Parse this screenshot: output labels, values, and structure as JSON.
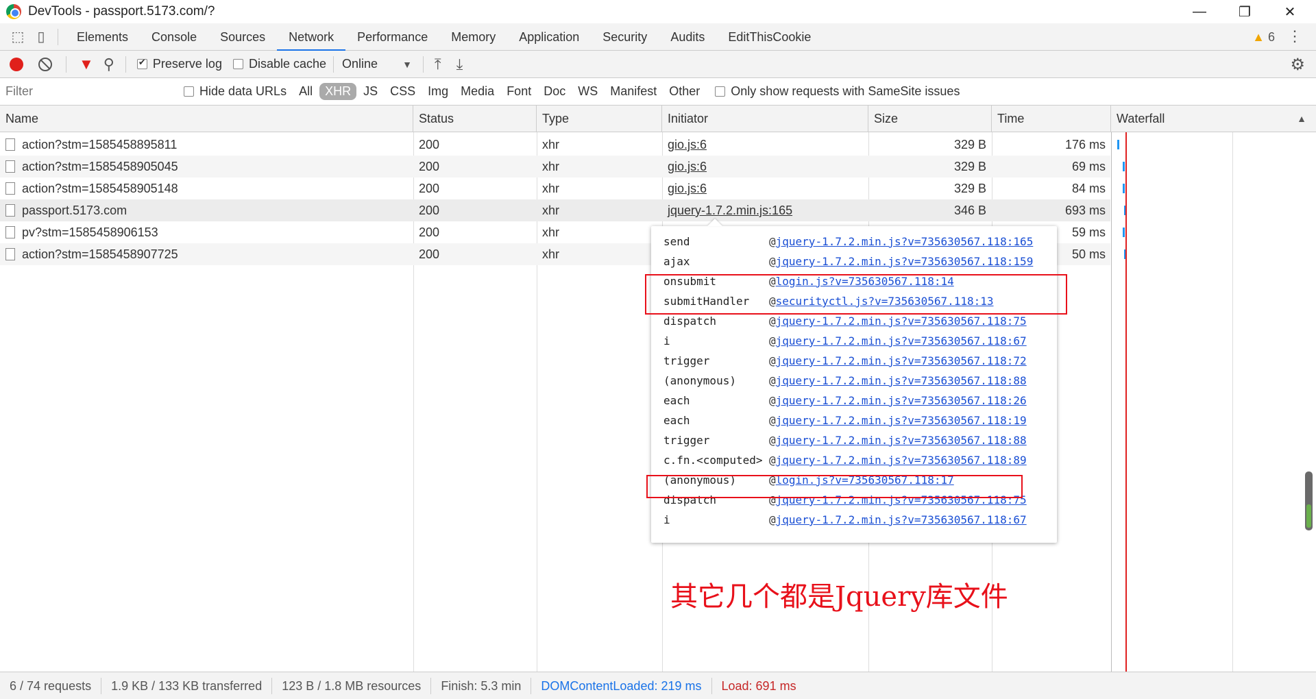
{
  "window": {
    "title": "DevTools - passport.5173.com/?",
    "minimize": "—",
    "restore": "❐",
    "close": "✕"
  },
  "tabs": [
    "Elements",
    "Console",
    "Sources",
    "Network",
    "Performance",
    "Memory",
    "Application",
    "Security",
    "Audits",
    "EditThisCookie"
  ],
  "active_tab": "Network",
  "warnings": {
    "icon": "warning-triangle-icon",
    "count": "6"
  },
  "toolbar": {
    "preserve_log": "Preserve log",
    "disable_cache": "Disable cache",
    "throttle": "Online",
    "preserve_checked": true
  },
  "filter": {
    "placeholder": "Filter",
    "hide_data_urls": "Hide data URLs",
    "types": [
      "All",
      "XHR",
      "JS",
      "CSS",
      "Img",
      "Media",
      "Font",
      "Doc",
      "WS",
      "Manifest",
      "Other"
    ],
    "active_type": "XHR",
    "samesite": "Only show requests with SameSite issues"
  },
  "columns": [
    "Name",
    "Status",
    "Type",
    "Initiator",
    "Size",
    "Time",
    "Waterfall"
  ],
  "rows": [
    {
      "name": "action?stm=1585458895811",
      "status": "200",
      "type": "xhr",
      "initiator": "gio.js:6",
      "size": "329 B",
      "time": "176 ms"
    },
    {
      "name": "action?stm=1585458905045",
      "status": "200",
      "type": "xhr",
      "initiator": "gio.js:6",
      "size": "329 B",
      "time": "69 ms"
    },
    {
      "name": "action?stm=1585458905148",
      "status": "200",
      "type": "xhr",
      "initiator": "gio.js:6",
      "size": "329 B",
      "time": "84 ms"
    },
    {
      "name": "passport.5173.com",
      "status": "200",
      "type": "xhr",
      "initiator": "jquery-1.7.2.min.js:165",
      "size": "346 B",
      "time": "693 ms"
    },
    {
      "name": "pv?stm=1585458906153",
      "status": "200",
      "type": "xhr",
      "initiator": "",
      "size": "",
      "time": "59 ms"
    },
    {
      "name": "action?stm=1585458907725",
      "status": "200",
      "type": "xhr",
      "initiator": "",
      "size": "",
      "time": "50 ms"
    }
  ],
  "stack": [
    {
      "fn": "send",
      "loc": "jquery-1.7.2.min.js?v=735630567.118:165"
    },
    {
      "fn": "ajax",
      "loc": "jquery-1.7.2.min.js?v=735630567.118:159"
    },
    {
      "fn": "onsubmit",
      "loc": "login.js?v=735630567.118:14"
    },
    {
      "fn": "submitHandler",
      "loc": "securityctl.js?v=735630567.118:13"
    },
    {
      "fn": "dispatch",
      "loc": "jquery-1.7.2.min.js?v=735630567.118:75"
    },
    {
      "fn": "i",
      "loc": "jquery-1.7.2.min.js?v=735630567.118:67"
    },
    {
      "fn": "trigger",
      "loc": "jquery-1.7.2.min.js?v=735630567.118:72"
    },
    {
      "fn": "(anonymous)",
      "loc": "jquery-1.7.2.min.js?v=735630567.118:88"
    },
    {
      "fn": "each",
      "loc": "jquery-1.7.2.min.js?v=735630567.118:26"
    },
    {
      "fn": "each",
      "loc": "jquery-1.7.2.min.js?v=735630567.118:19"
    },
    {
      "fn": "trigger",
      "loc": "jquery-1.7.2.min.js?v=735630567.118:88"
    },
    {
      "fn": "c.fn.<computed>",
      "loc": "jquery-1.7.2.min.js?v=735630567.118:89"
    },
    {
      "fn": "(anonymous)",
      "loc": "login.js?v=735630567.118:17"
    },
    {
      "fn": "dispatch",
      "loc": "jquery-1.7.2.min.js?v=735630567.118:75"
    },
    {
      "fn": "i",
      "loc": "jquery-1.7.2.min.js?v=735630567.118:67"
    }
  ],
  "at_sign": "@",
  "annotation": "其它几个都是Jquery库文件",
  "status": {
    "requests": "6 / 74 requests",
    "transferred": "1.9 KB / 133 KB transferred",
    "resources": "123 B / 1.8 MB resources",
    "finish": "Finish: 5.3 min",
    "dcl": "DOMContentLoaded: 219 ms",
    "load": "Load: 691 ms"
  },
  "colors": {
    "accent": "#1a73e8",
    "highlight": "#e8101a",
    "record": "#e0201b"
  }
}
